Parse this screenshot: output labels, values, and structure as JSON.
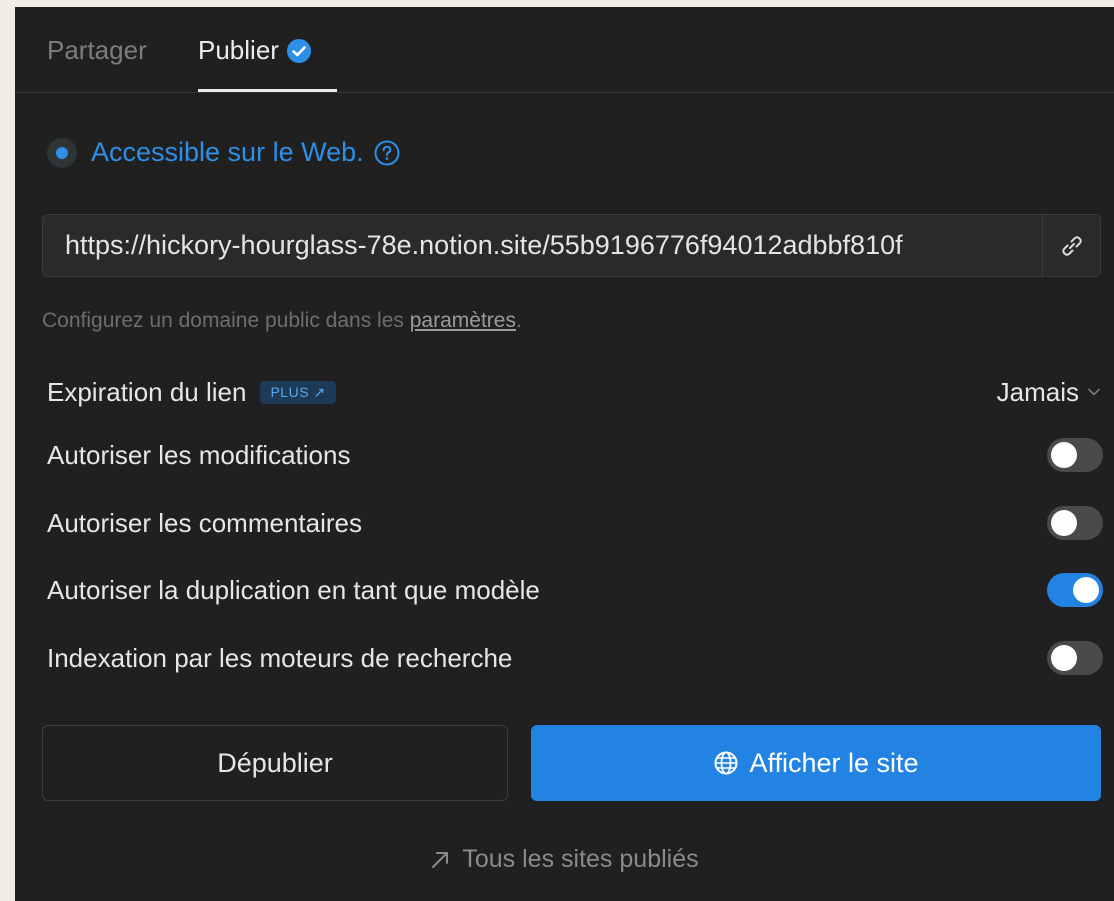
{
  "tabs": {
    "share_label": "Partager",
    "publish_label": "Publier"
  },
  "access": {
    "label": "Accessible sur le Web.",
    "selected": true
  },
  "url": {
    "value": "https://hickory-hourglass-78e.notion.site/55b9196776f94012adbbf810f"
  },
  "domain_hint": {
    "text": "Configurez un domaine public dans les ",
    "link": "paramètres",
    "suffix": "."
  },
  "expiration": {
    "label": "Expiration du lien",
    "badge": "PLUS ↗",
    "value": "Jamais"
  },
  "settings": [
    {
      "label": "Autoriser les modifications",
      "on": false
    },
    {
      "label": "Autoriser les commentaires",
      "on": false
    },
    {
      "label": "Autoriser la duplication en tant que modèle",
      "on": true
    },
    {
      "label": "Indexation par les moteurs de recherche",
      "on": false
    }
  ],
  "buttons": {
    "unpublish": "Dépublier",
    "view_site": "Afficher le site"
  },
  "footer": {
    "all_sites": "Tous les sites publiés"
  },
  "colors": {
    "accent": "#2383e2",
    "panel_bg": "#202020"
  }
}
